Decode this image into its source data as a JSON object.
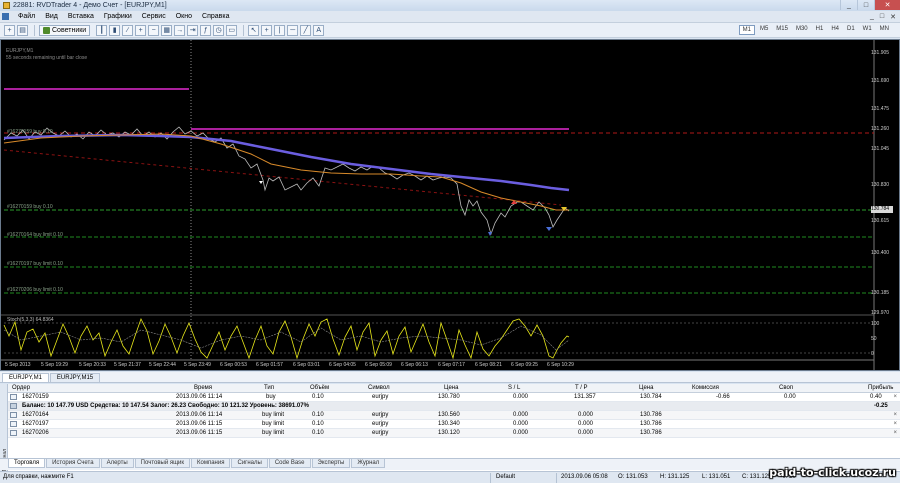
{
  "window": {
    "title": "22881: RVDTrader 4 - Демо Счет - [EURJPY,M1]",
    "controls": [
      "_",
      "□",
      "✕"
    ]
  },
  "menu": {
    "items": [
      "Файл",
      "Вид",
      "Вставка",
      "Графики",
      "Сервис",
      "Окно",
      "Справка"
    ],
    "mdi_controls": [
      "_",
      "□",
      "✕"
    ]
  },
  "toolbar": {
    "advisors_label": "Советники",
    "timeframes": [
      "M1",
      "M5",
      "M15",
      "M30",
      "H1",
      "H4",
      "D1",
      "W1",
      "MN"
    ],
    "active_timeframe": "M1"
  },
  "chart": {
    "info_line1": "EURJPY,M1",
    "info_line2": "55 seconds remaining until bar close",
    "order_labels": [
      "#16270159 buy 0.10",
      "#16270159 buy 0.10",
      "#16270164 buy limit 0.10",
      "#16270197 buy limit 0.10",
      "#16270206 buy limit 0.10"
    ],
    "price_ticks": [
      "131.905",
      "131.690",
      "131.475",
      "131.260",
      "131.045",
      "130.830",
      "130.615",
      "130.400",
      "130.185",
      "129.970",
      "100",
      "50",
      "0"
    ],
    "current_price": "130.784",
    "time_ticks": [
      "5 Sep 2013",
      "5 Sep 19:29",
      "5 Sep 20:33",
      "5 Sep 21:37",
      "5 Sep 22:44",
      "5 Sep 23:49",
      "6 Sep 00:53",
      "6 Sep 01:57",
      "6 Sep 03:01",
      "6 Sep 04:05",
      "6 Sep 05:09",
      "6 Sep 06:13",
      "6 Sep 07:17",
      "6 Sep 08:21",
      "6 Sep 09:25",
      "6 Sep 10:29"
    ],
    "oscillator_label": "Stoch(5,3,3) 64.8364",
    "colors": {
      "price": "#c0c0c0",
      "ma_fast": "#d88a2a",
      "ma_slow": "#6b5ee0",
      "hline": "#e22ad0",
      "stop_line": "#c01c1c",
      "order_line": "#1f8a1f",
      "oscillator": "#e8e81a"
    }
  },
  "chart_tabs": [
    "EURJPY,M1",
    "EURJPY,M15"
  ],
  "terminal": {
    "side_label": "Терминал",
    "columns": [
      "Ордер",
      "Время",
      "Тип",
      "Объём",
      "Символ",
      "Цена",
      "S / L",
      "T / P",
      "Цена",
      "Комиссия",
      "Своп",
      "Прибыль"
    ],
    "open_order": {
      "ticket": "16270159",
      "time": "2013.09.06 11:14",
      "type": "buy",
      "volume": "0.10",
      "symbol": "eurjpy",
      "price": "130.780",
      "sl": "0.000",
      "tp": "131.357",
      "cur_price": "130.784",
      "commission": "-0.66",
      "swap": "0.00",
      "profit": "0.40"
    },
    "balance_line": "Баланс: 10 147.79 USD  Средства: 10 147.54  Залог: 26.23  Свободно: 10 121.32  Уровень: 38691.07%",
    "balance_profit": "-0.25",
    "pending_orders": [
      {
        "ticket": "16270164",
        "time": "2013.09.06 11:14",
        "type": "buy limit",
        "volume": "0.10",
        "symbol": "eurjpy",
        "price": "130.560",
        "sl": "0.000",
        "tp": "0.000",
        "cur_price": "130.786"
      },
      {
        "ticket": "16270197",
        "time": "2013.09.06 11:15",
        "type": "buy limit",
        "volume": "0.10",
        "symbol": "eurjpy",
        "price": "130.340",
        "sl": "0.000",
        "tp": "0.000",
        "cur_price": "130.786"
      },
      {
        "ticket": "16270206",
        "time": "2013.09.06 11:15",
        "type": "buy limit",
        "volume": "0.10",
        "symbol": "eurjpy",
        "price": "130.120",
        "sl": "0.000",
        "tp": "0.000",
        "cur_price": "130.786"
      }
    ],
    "close_glyph": "×",
    "tabs": [
      "Торговля",
      "История Счета",
      "Алерты",
      "Почтовый ящик",
      "Компания",
      "Сигналы",
      "Code Base",
      "Эксперты",
      "Журнал"
    ],
    "active_tab": "Торговля"
  },
  "status": {
    "help": "Для справки, нажмите F1",
    "profile": "Default",
    "datetime": "2013.09.06 05:08",
    "open": "O: 131.053",
    "high": "H: 131.125",
    "low": "L: 131.051",
    "close": "C: 131.125",
    "volume": "V: 20",
    "watermark": "paid-to-click.ucoz.ru"
  }
}
